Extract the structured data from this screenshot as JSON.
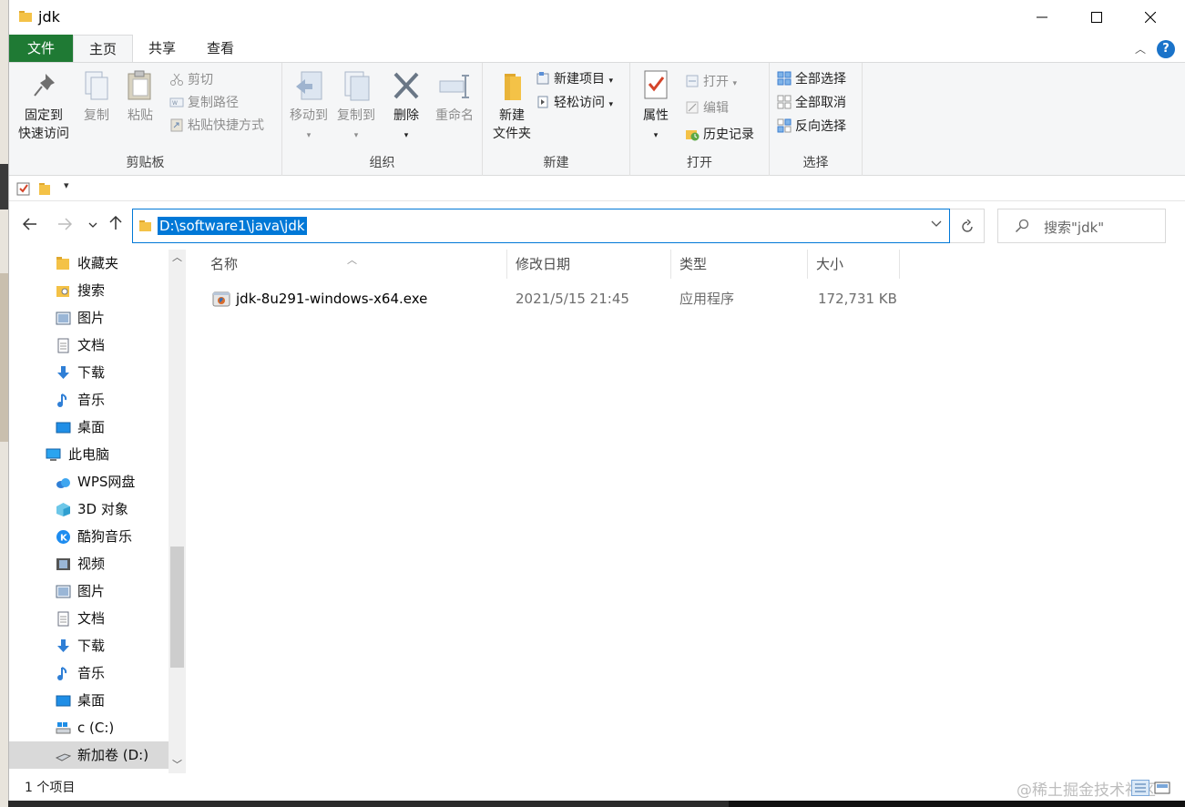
{
  "window": {
    "title": "jdk"
  },
  "ribbon_tabs": {
    "file": "文件",
    "home": "主页",
    "share": "共享",
    "view": "查看"
  },
  "ribbon": {
    "clipboard": {
      "label": "剪贴板",
      "pin_line1": "固定到",
      "pin_line2": "快速访问",
      "copy": "复制",
      "paste": "粘贴",
      "cut": "剪切",
      "copy_path": "复制路径",
      "paste_shortcut": "粘贴快捷方式"
    },
    "organize": {
      "label": "组织",
      "move_to": "移动到",
      "copy_to": "复制到",
      "delete": "删除",
      "rename": "重命名"
    },
    "new": {
      "label": "新建",
      "new_folder_line1": "新建",
      "new_folder_line2": "文件夹",
      "new_item": "新建项目",
      "easy_access": "轻松访问"
    },
    "open": {
      "label": "打开",
      "properties": "属性",
      "open": "打开",
      "edit": "编辑",
      "history": "历史记录"
    },
    "select": {
      "label": "选择",
      "select_all": "全部选择",
      "select_none": "全部取消",
      "invert": "反向选择"
    }
  },
  "address": {
    "path": "D:\\software1\\java\\jdk"
  },
  "search": {
    "placeholder": "搜索\"jdk\""
  },
  "nav": {
    "items": [
      {
        "label": "收藏夹",
        "icon": "star-folder-icon"
      },
      {
        "label": "搜索",
        "icon": "search-folder-icon"
      },
      {
        "label": "图片",
        "icon": "pictures-icon"
      },
      {
        "label": "文档",
        "icon": "documents-icon"
      },
      {
        "label": "下载",
        "icon": "download-icon"
      },
      {
        "label": "音乐",
        "icon": "music-icon"
      },
      {
        "label": "桌面",
        "icon": "desktop-icon"
      },
      {
        "label": "此电脑",
        "icon": "this-pc-icon"
      },
      {
        "label": "WPS网盘",
        "icon": "cloud-icon"
      },
      {
        "label": "3D 对象",
        "icon": "3d-objects-icon"
      },
      {
        "label": "酷狗音乐",
        "icon": "kugou-icon"
      },
      {
        "label": "视频",
        "icon": "video-icon"
      },
      {
        "label": "图片",
        "icon": "pictures-icon"
      },
      {
        "label": "文档",
        "icon": "documents-icon"
      },
      {
        "label": "下载",
        "icon": "download-icon"
      },
      {
        "label": "音乐",
        "icon": "music-icon"
      },
      {
        "label": "桌面",
        "icon": "desktop-icon"
      },
      {
        "label": "c (C:)",
        "icon": "drive-c-icon"
      },
      {
        "label": "新加卷 (D:)",
        "icon": "drive-icon"
      }
    ]
  },
  "columns": {
    "name": "名称",
    "date": "修改日期",
    "type": "类型",
    "size": "大小"
  },
  "files": [
    {
      "name": "jdk-8u291-windows-x64.exe",
      "date": "2021/5/15 21:45",
      "type": "应用程序",
      "size": "172,731 KB"
    }
  ],
  "status": {
    "count": "1 个项目",
    "watermark": "@稀土掘金技术社区"
  },
  "colors": {
    "accent": "#0078d7",
    "file_tab": "#1f7a34",
    "folder": "#f4c247"
  }
}
